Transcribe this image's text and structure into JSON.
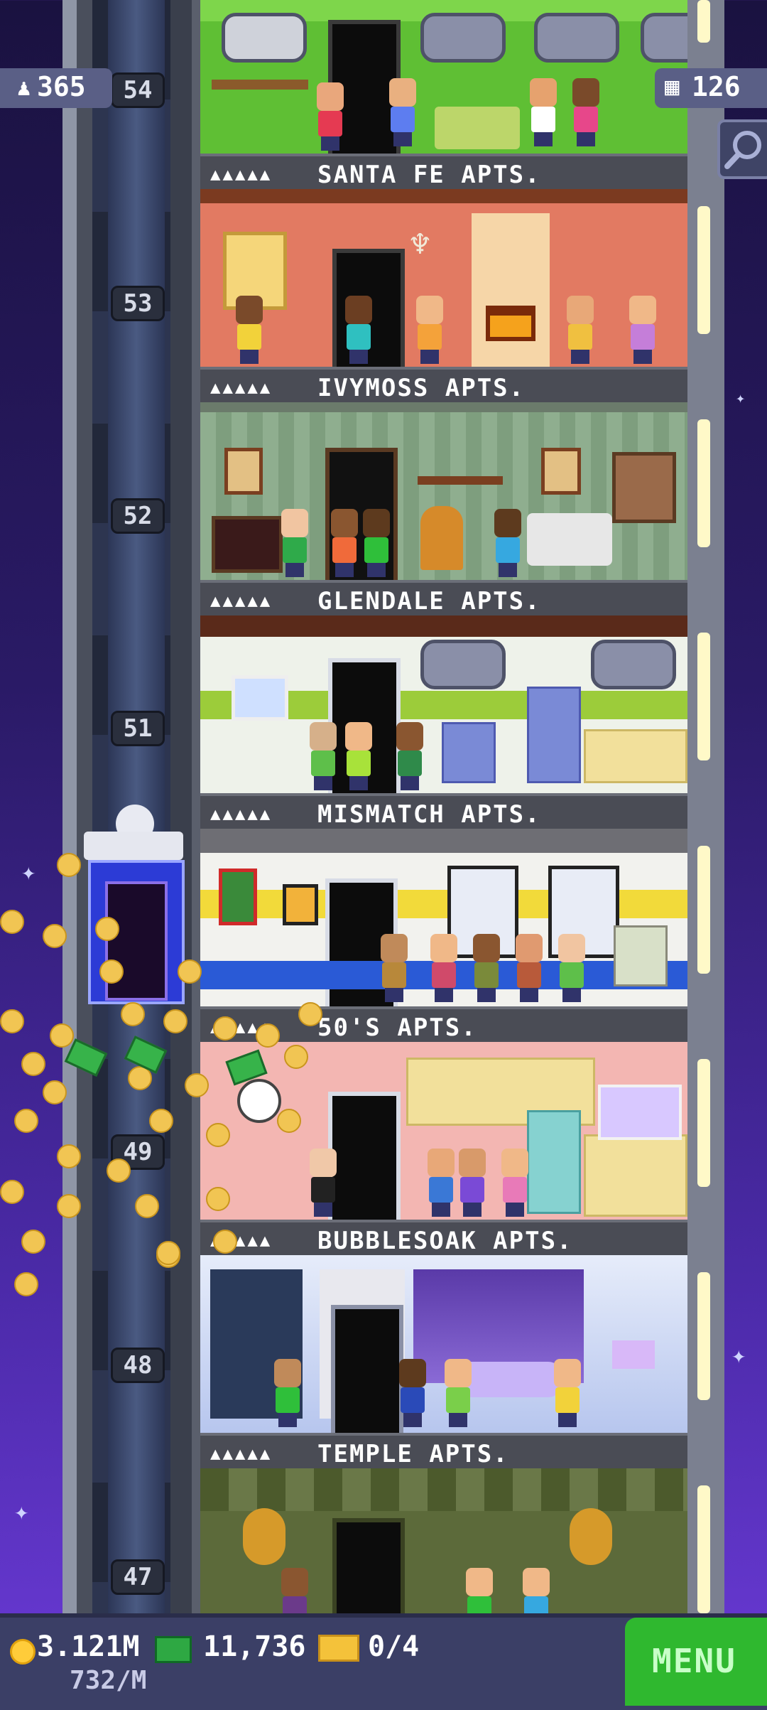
{
  "hud": {
    "population_label": "365",
    "population_icon": "person-icon",
    "floors_count": "126",
    "floors_icon": "building-icon",
    "search_icon": "magnifier-icon"
  },
  "floors": [
    {
      "number": "54",
      "name": "SANTA FE APTS.",
      "dots": "▲▲▲▲▲",
      "color": "#5fbf34"
    },
    {
      "number": "53",
      "name": "IVYMOSS APTS.",
      "dots": "▲▲▲▲▲",
      "color": "#e27a62"
    },
    {
      "number": "52",
      "name": "GLENDALE APTS.",
      "dots": "▲▲▲▲▲",
      "color": "#8fae8f"
    },
    {
      "number": "51",
      "name": "MISMATCH APTS.",
      "dots": "▲▲▲▲▲",
      "color": "#e9f0e6"
    },
    {
      "number": "",
      "name": "50'S APTS.",
      "dots": "▲▲▲▲▲",
      "color": "#f2f2ee"
    },
    {
      "number": "49",
      "name": "BUBBLESOAK APTS.",
      "dots": "▲▲▲▲▲",
      "color": "#f3b6b2"
    },
    {
      "number": "48",
      "name": "TEMPLE APTS.",
      "dots": "▲▲▲▲▲",
      "color": "#c9d8f4"
    },
    {
      "number": "47",
      "name": "",
      "dots": "",
      "color": "#5c6a3a"
    }
  ],
  "bottom": {
    "coins": "3.121M",
    "coins_rate": "732/M",
    "bux": "11,736",
    "tickets": "0/4",
    "menu_label": "MENU"
  },
  "colors": {
    "menu_green": "#2fb82f",
    "hud_bg": "#5a5f86",
    "bottom_bg": "#3b3f66",
    "coin_gold": "#ffcc3a",
    "bux_green": "#2ea843"
  }
}
